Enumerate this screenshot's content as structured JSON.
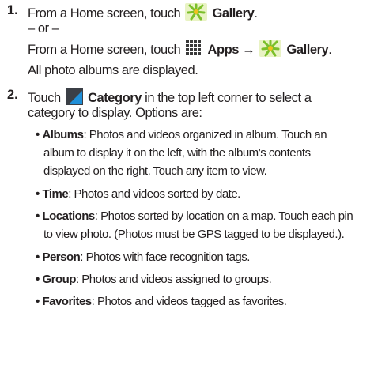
{
  "step1": {
    "number": "1.",
    "line1_pre": "From a Home screen, touch",
    "gallery": "Gallery",
    "or": "– or –",
    "line3_pre": "From a Home screen, touch",
    "apps": "Apps",
    "arrow": "→",
    "gallery2": "Gallery",
    "line4": "All photo albums are displayed."
  },
  "step2": {
    "number": "2.",
    "pre": "Touch",
    "category": "Category",
    "post": "in the top left corner to select a",
    "line2": "category to display. Options are:"
  },
  "options": [
    {
      "term": "Albums",
      "lines": [
        ": Photos and videos organized in album. Touch an",
        "album to display it on the left, with the album’s contents",
        "displayed on the right. Touch any item to view."
      ]
    },
    {
      "term": "Time",
      "lines": [
        ": Photos and videos sorted by date."
      ]
    },
    {
      "term": "Locations",
      "lines": [
        ": Photos sorted by location on a map. Touch each pin",
        "to view photo. (Photos must be GPS tagged to be displayed.)."
      ]
    },
    {
      "term": "Person",
      "lines": [
        ": Photos with face recognition tags."
      ]
    },
    {
      "term": "Group",
      "lines": [
        ": Photos and videos assigned to groups."
      ]
    },
    {
      "term": "Favorites",
      "lines": [
        ": Photos and videos tagged as favorites."
      ]
    }
  ],
  "bullet": "•"
}
